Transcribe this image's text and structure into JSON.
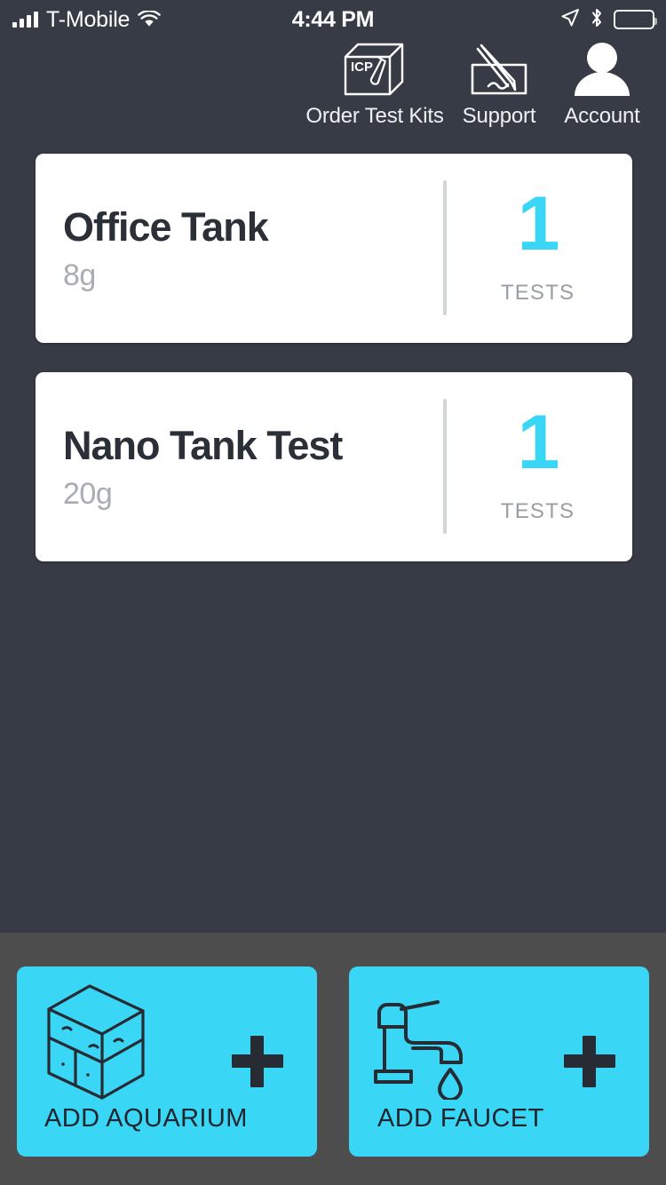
{
  "statusbar": {
    "carrier": "T-Mobile",
    "time": "4:44 PM",
    "signal_icon": "cellular-bars-icon",
    "wifi_icon": "wifi-icon",
    "location_icon": "location-arrow-icon",
    "bluetooth_icon": "bluetooth-icon",
    "battery_icon": "battery-icon"
  },
  "topnav": {
    "items": [
      {
        "label": "Order Test Kits",
        "icon": "icp-test-kit-box-icon",
        "box_text": "ICP"
      },
      {
        "label": "Support",
        "icon": "pen-signing-form-icon"
      },
      {
        "label": "Account",
        "icon": "person-account-icon"
      }
    ]
  },
  "tanks": [
    {
      "name": "Office Tank",
      "volume": "8g",
      "count": "1",
      "count_label": "TESTS"
    },
    {
      "name": "Nano Tank Test",
      "volume": "20g",
      "count": "1",
      "count_label": "TESTS"
    }
  ],
  "bottombar": {
    "buttons": [
      {
        "label": "ADD AQUARIUM",
        "icon": "aquarium-tank-icon",
        "plus_icon": "plus-icon"
      },
      {
        "label": "ADD FAUCET",
        "icon": "faucet-drip-icon",
        "plus_icon": "plus-icon"
      }
    ]
  },
  "colors": {
    "background": "#373b45",
    "bottom_bar": "#4d4d4d",
    "accent_cyan": "#3ad6f5",
    "card": "#ffffff",
    "muted_text": "#9a9ea4"
  }
}
